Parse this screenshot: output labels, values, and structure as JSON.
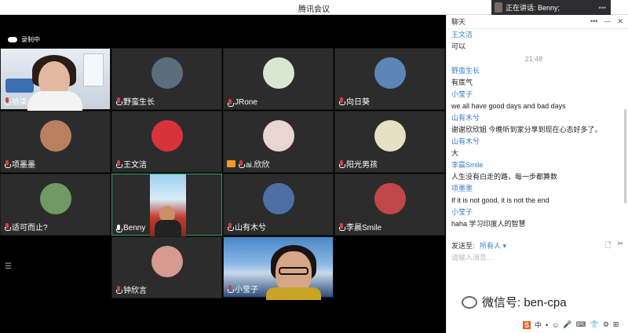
{
  "window": {
    "title": "腾讯会议"
  },
  "speaking": {
    "label": "正在讲话: Benny;",
    "more": "•••"
  },
  "recording": {
    "label": "录制中"
  },
  "tiles": [
    {
      "name": "拾柒",
      "kind": "video1"
    },
    {
      "name": "野蛮生长",
      "avatar_color": "#5c6e7b"
    },
    {
      "name": "JRone",
      "avatar_color": "#d9e6d2"
    },
    {
      "name": "向日葵",
      "avatar_color": "#5b86b6"
    },
    {
      "name": "项墨墨",
      "avatar_color": "#b98060"
    },
    {
      "name": "王文洁",
      "avatar_color": "#d8333b"
    },
    {
      "name": "ai.欣欣",
      "avatar_color": "#e8d6d2",
      "camera_off_icon": true
    },
    {
      "name": "阳光男孩",
      "avatar_color": "#e6e1c6"
    },
    {
      "name": "适可而止?",
      "avatar_color": "#6f9a63"
    },
    {
      "name": "Benny",
      "kind": "video2",
      "active": true
    },
    {
      "name": "山有木兮",
      "avatar_color": "#4e6fa6"
    },
    {
      "name": "李晨Smile",
      "avatar_color": "#c0474a"
    },
    {
      "name": "钟欣言",
      "avatar_color": "#d79a90"
    },
    {
      "name": "小莹子",
      "kind": "video3"
    }
  ],
  "chat": {
    "title": "聊天",
    "controls": [
      "•••",
      "—",
      "✕"
    ],
    "messages": [
      {
        "sender": "王文洁",
        "text": "可以"
      },
      {
        "time": "21:48"
      },
      {
        "sender": "野蛮生长",
        "text": "有底气"
      },
      {
        "sender": "小莹子",
        "text": "we all have good days and bad days"
      },
      {
        "sender": "山有木兮",
        "text": "谢谢欣欣姐 今晚听到家分享到现在心态好多了。"
      },
      {
        "sender": "山有木兮",
        "text": "大"
      },
      {
        "sender": "李晨Smile",
        "text": "人生没有白走的路，每一步都算数"
      },
      {
        "sender": "项墨墨",
        "text": "If it is not good, it is not the end"
      },
      {
        "sender": "小莹子",
        "text": "haha  学习印度人的智慧"
      }
    ],
    "send_to_label": "发送至:",
    "send_to_value": "所有人",
    "input_placeholder": "请输入消息..."
  },
  "watermark": {
    "text": "微信号: ben-cpa"
  },
  "ime": {
    "s": "S",
    "items": [
      "中",
      "•",
      "☺",
      "🎤",
      "⌨",
      "👕",
      "⚙",
      "⊞"
    ]
  }
}
